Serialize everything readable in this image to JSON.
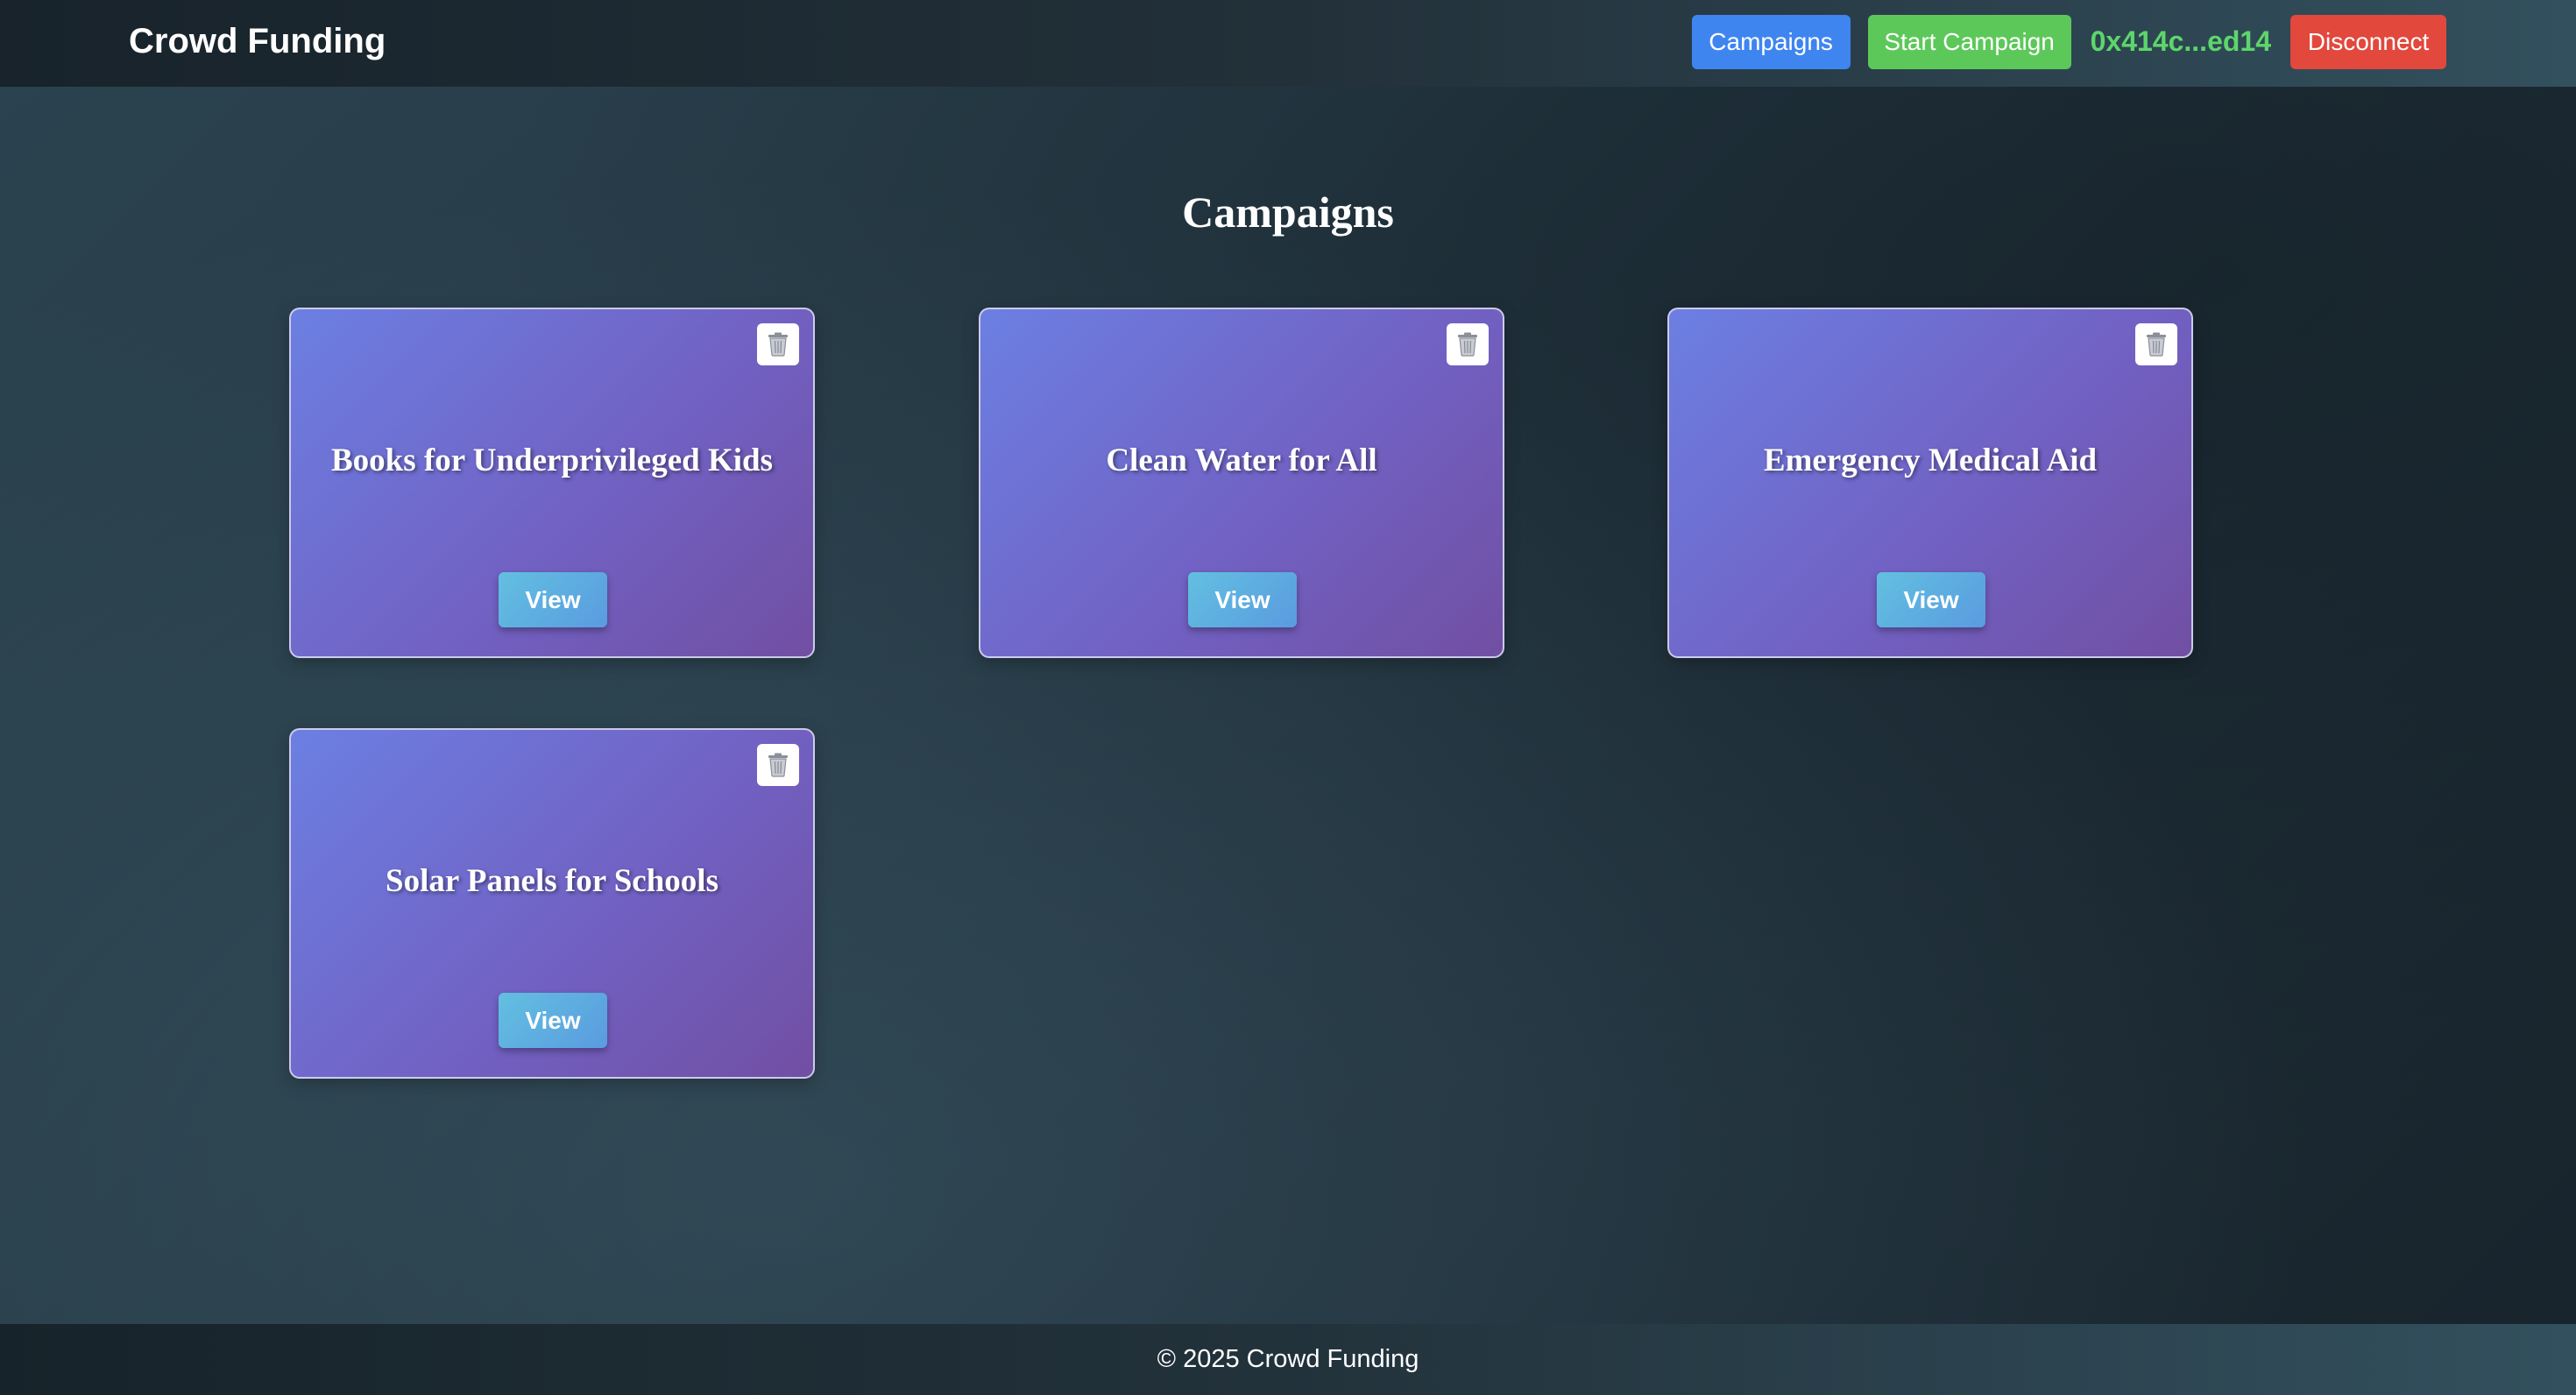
{
  "header": {
    "brand": "Crowd Funding",
    "nav": {
      "campaigns_label": "Campaigns",
      "start_campaign_label": "Start Campaign",
      "wallet_address": "0x414c...ed14",
      "disconnect_label": "Disconnect"
    }
  },
  "main": {
    "title": "Campaigns",
    "campaigns": [
      {
        "title": "Books for Underprivileged Kids",
        "view_label": "View",
        "delete_icon": "trash-icon"
      },
      {
        "title": "Clean Water for All",
        "view_label": "View",
        "delete_icon": "trash-icon"
      },
      {
        "title": "Emergency Medical Aid",
        "view_label": "View",
        "delete_icon": "trash-icon"
      },
      {
        "title": "Solar Panels for Schools",
        "view_label": "View",
        "delete_icon": "trash-icon"
      }
    ]
  },
  "footer": {
    "text": "© 2025 Crowd Funding"
  },
  "colors": {
    "campaigns_button": "#3f85f0",
    "start_campaign_button": "#5dc85a",
    "wallet_text": "#5dd66b",
    "disconnect_button": "#e2483c",
    "card_gradient_start": "#6c7fe2",
    "card_gradient_end": "#714fa3",
    "view_button": "#5fb0e0"
  }
}
